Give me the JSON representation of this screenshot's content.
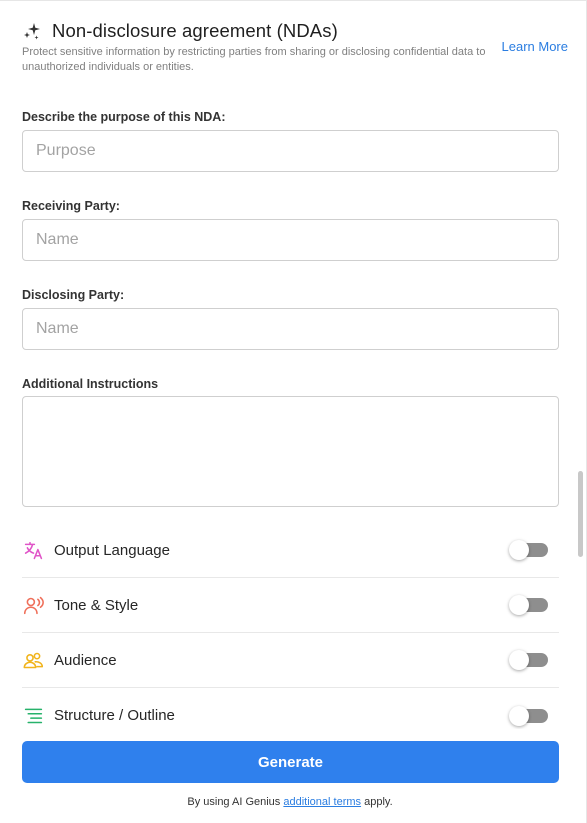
{
  "header": {
    "title": "Non-disclosure agreement (NDAs)",
    "subtitle": "Protect sensitive information by restricting parties from sharing or disclosing confidential data to unauthorized individuals or entities.",
    "learn_more": "Learn More",
    "icon": "sparkle-icon"
  },
  "form": {
    "purpose": {
      "label": "Describe the purpose of this NDA:",
      "placeholder": "Purpose",
      "value": ""
    },
    "receiving": {
      "label": "Receiving Party:",
      "placeholder": "Name",
      "value": ""
    },
    "disclosing": {
      "label": "Disclosing Party:",
      "placeholder": "Name",
      "value": ""
    },
    "instructions": {
      "label": "Additional Instructions",
      "value": ""
    }
  },
  "options": [
    {
      "label": "Output Language",
      "icon": "translate-icon",
      "icon_color": "#e055c8",
      "enabled": false
    },
    {
      "label": "Tone & Style",
      "icon": "speaker-person-icon",
      "icon_color": "#ef6f5a",
      "enabled": false
    },
    {
      "label": "Audience",
      "icon": "group-icon",
      "icon_color": "#f1b41c",
      "enabled": false
    },
    {
      "label": "Structure / Outline",
      "icon": "outline-icon",
      "icon_color": "#27b26b",
      "enabled": false
    }
  ],
  "footer": {
    "generate": "Generate",
    "terms_prefix": "By using AI Genius",
    "terms_link": "additional terms",
    "terms_suffix": "apply."
  },
  "colors": {
    "accent": "#2f80ed",
    "link": "#2a7de1",
    "toggle_off": "#8e8e8e"
  }
}
